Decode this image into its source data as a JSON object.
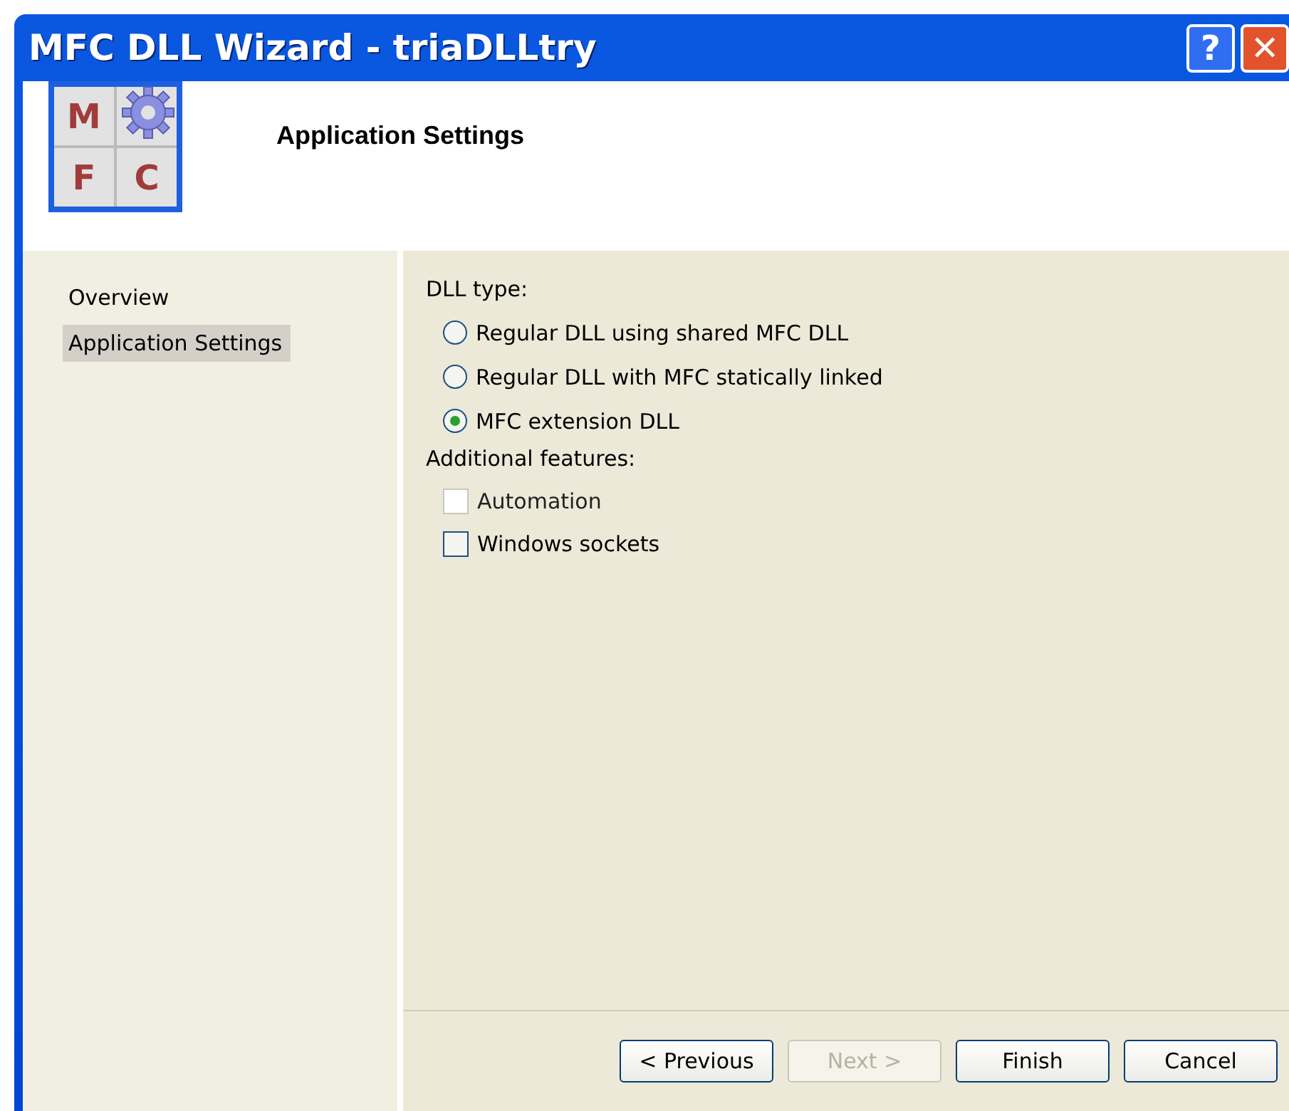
{
  "window": {
    "title": "MFC DLL Wizard - triaDLLtry",
    "title_buttons": [
      "?",
      "✕"
    ]
  },
  "logo": {
    "letters": [
      "M",
      "F",
      "C"
    ]
  },
  "header": {
    "title": "Application Settings"
  },
  "sidebar": {
    "items": [
      {
        "label": "Overview",
        "selected": false
      },
      {
        "label": "Application Settings",
        "selected": true
      }
    ]
  },
  "dll_type": {
    "label": "DLL type:",
    "options": [
      {
        "label": "Regular DLL using shared MFC DLL",
        "selected": false
      },
      {
        "label": "Regular DLL with MFC statically linked",
        "selected": false
      },
      {
        "label": "MFC extension DLL",
        "selected": true
      }
    ]
  },
  "features": {
    "label": "Additional features:",
    "options": [
      {
        "label": "Automation",
        "checked": false,
        "disabled": true
      },
      {
        "label": "Windows sockets",
        "checked": false,
        "disabled": false
      }
    ]
  },
  "buttons": [
    {
      "label": "< Previous",
      "disabled": false
    },
    {
      "label": "Next >",
      "disabled": true
    },
    {
      "label": "Finish",
      "disabled": false
    },
    {
      "label": "Cancel",
      "disabled": false
    }
  ]
}
